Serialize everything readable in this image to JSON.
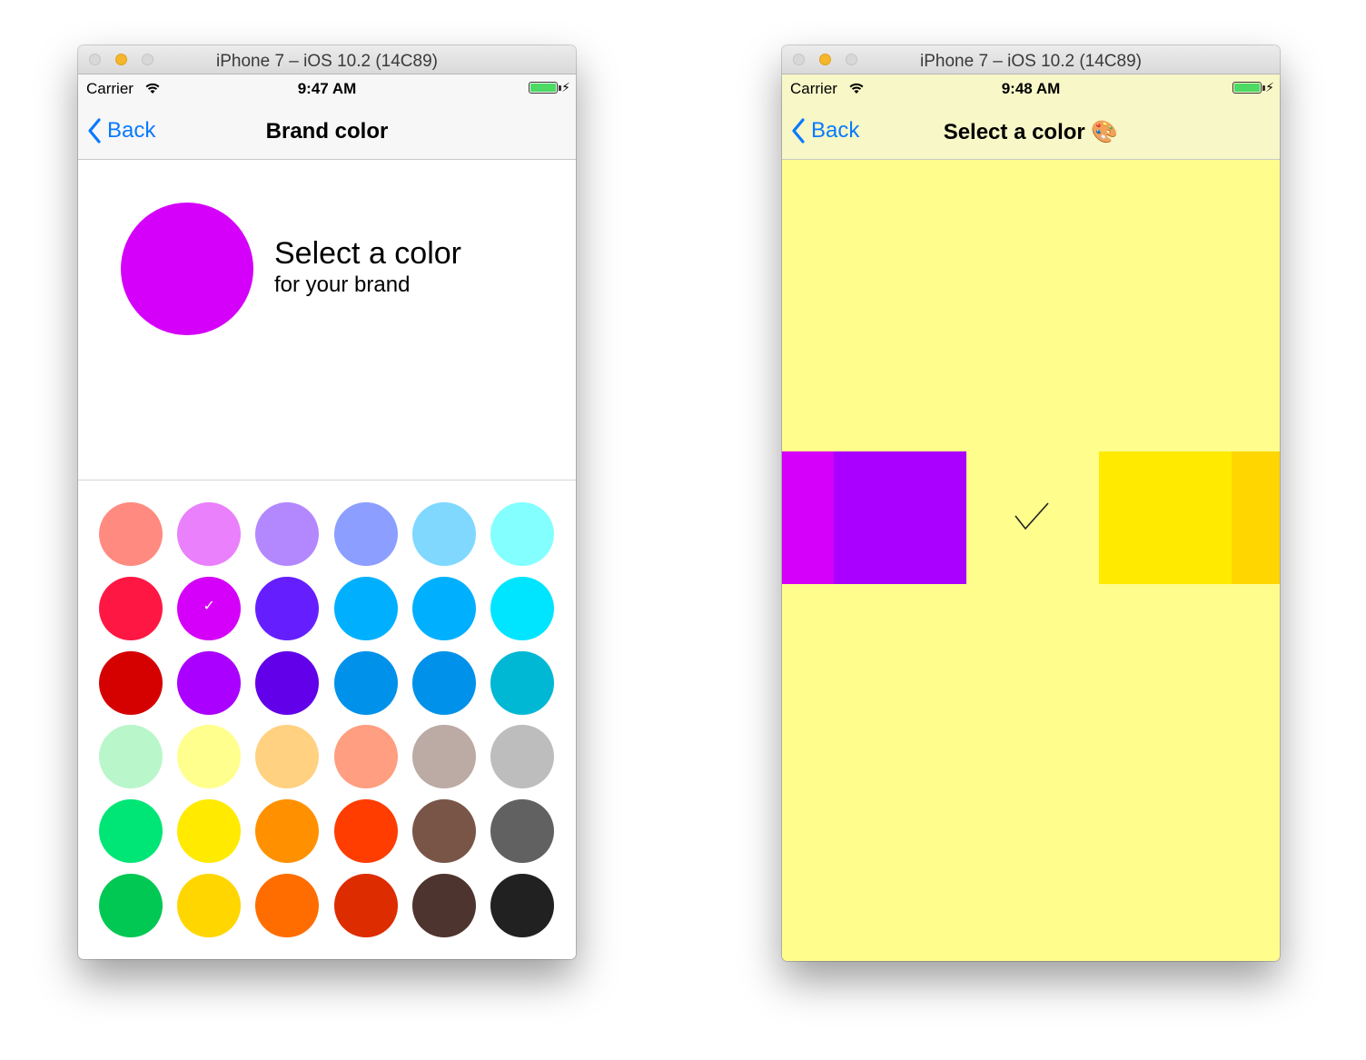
{
  "left": {
    "window_title": "iPhone 7 – iOS 10.2 (14C89)",
    "status": {
      "carrier": "Carrier",
      "time": "9:47 AM"
    },
    "nav": {
      "back": "Back",
      "title": "Brand color"
    },
    "preview": {
      "heading": "Select a color",
      "subtitle": "for your brand",
      "color": "#d500f9"
    },
    "selected_index": 7,
    "swatch_colors": [
      "#ff8a80",
      "#ea80fc",
      "#b388ff",
      "#8c9eff",
      "#80d8ff",
      "#84ffff",
      "#ff1744",
      "#d500f9",
      "#651fff",
      "#00b0ff",
      "#00b0ff",
      "#00e5ff",
      "#d50000",
      "#aa00ff",
      "#6200ea",
      "#0091ea",
      "#0091ea",
      "#00b8d4",
      "#b9f6ca",
      "#ffff8d",
      "#ffd180",
      "#ff9e80",
      "#bcaaa4",
      "#bdbdbd",
      "#00e676",
      "#ffea00",
      "#ff9100",
      "#ff3d00",
      "#795548",
      "#616161",
      "#00c853",
      "#ffd600",
      "#ff6d00",
      "#dd2c00",
      "#4e342e",
      "#212121"
    ],
    "check_glyph": "✓"
  },
  "right": {
    "window_title": "iPhone 7 – iOS 10.2 (14C89)",
    "status": {
      "carrier": "Carrier",
      "time": "9:48 AM"
    },
    "nav": {
      "back": "Back",
      "title": "Select a color 🎨"
    },
    "background": "#fffd8c",
    "strip_colors": [
      "#d500f9",
      "#aa00ff",
      "#ffea00",
      "#ffd600"
    ]
  }
}
